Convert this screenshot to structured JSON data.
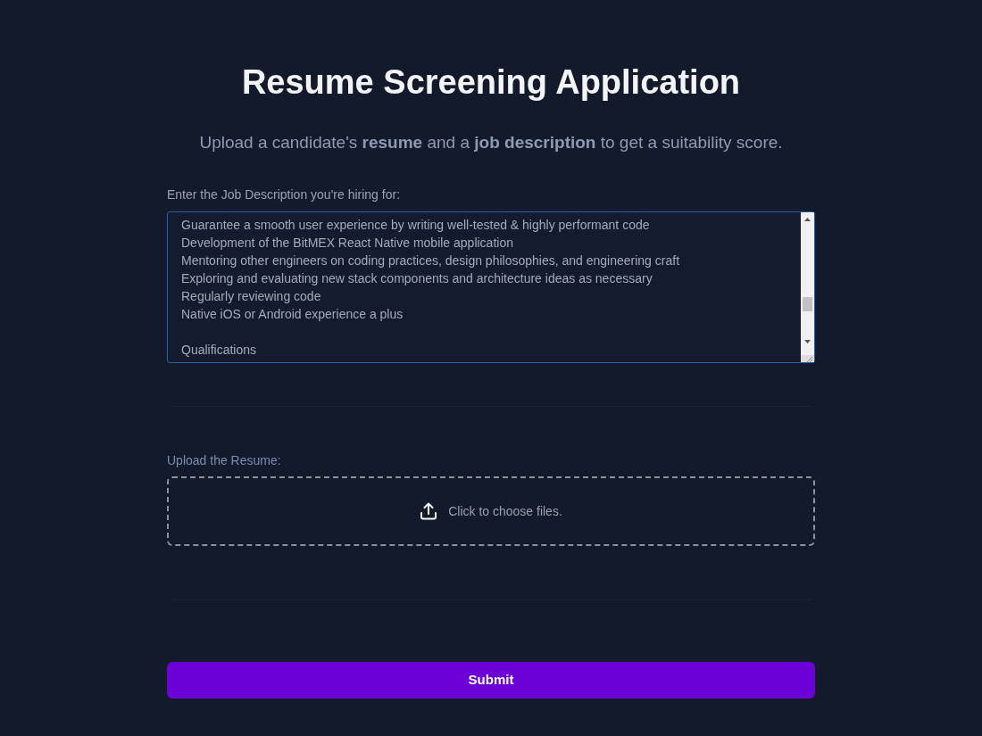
{
  "title": "Resume Screening Application",
  "subtitle": "Upload a candidate's **resume** and a **job description** to get a suitability score.",
  "job_description": {
    "label": "Enter the Job Description you're hiring for:",
    "value": "Guarantee a smooth user experience by writing well-tested & highly performant code\nDevelopment of the BitMEX React Native mobile application\nMentoring other engineers on coding practices, design philosophies, and engineering craft\nExploring and evaluating new stack components and architecture ideas as necessary\nRegularly reviewing code\nNative iOS or Android experience a plus\n\nQualifications"
  },
  "resume_upload": {
    "label": "Upload the Resume:",
    "prompt": "Click to choose files."
  },
  "submit_button": {
    "label": "Submit"
  }
}
